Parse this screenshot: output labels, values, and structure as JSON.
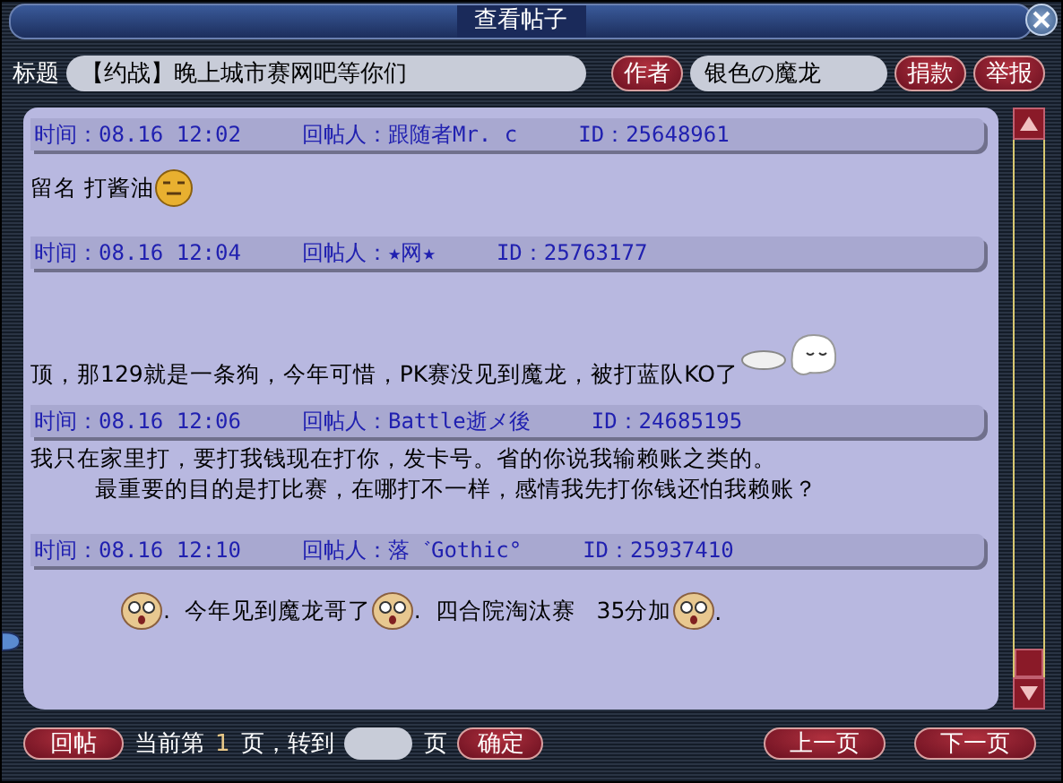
{
  "window": {
    "title": "查看帖子"
  },
  "subject": {
    "label": "标题",
    "value": "【约战】晚上城市赛网吧等你们"
  },
  "author": {
    "button": "作者",
    "value": "银色の魔龙"
  },
  "actions": [
    "捐款",
    "举报"
  ],
  "posts": [
    {
      "time_label": "时间：",
      "time": "08.16 12:02",
      "poster_label": "回帖人：",
      "poster": "跟随者Mr. c",
      "id_label": "ID：",
      "id": "25648961",
      "lines": [
        [
          {
            "kind": "text",
            "text": "留名 打酱油"
          },
          {
            "kind": "grin-face"
          }
        ]
      ]
    },
    {
      "time_label": "时间：",
      "time": "08.16 12:04",
      "poster_label": "回帖人：",
      "poster": "★网★",
      "id_label": "ID：",
      "id": "25763177",
      "lines": [
        [
          {
            "kind": "text",
            "text": "顶，那129就是一条狗，今年可惜，PK赛没见到魔龙，被打蓝队KO了"
          },
          {
            "kind": "ghost"
          }
        ]
      ]
    },
    {
      "time_label": "时间：",
      "time": "08.16 12:06",
      "poster_label": "回帖人：",
      "poster": "Battle逝メ後",
      "id_label": "ID：",
      "id": "24685195",
      "lines": [
        [
          {
            "kind": "text",
            "text": "我只在家里打，要打我钱现在打你，发卡号。省的你说我输赖账之类的。"
          }
        ],
        [
          {
            "kind": "text",
            "text": "最重要的目的是打比赛，在哪打不一样，感情我先打你钱还怕我赖账？"
          }
        ]
      ]
    },
    {
      "time_label": "时间：",
      "time": "08.16 12:10",
      "poster_label": "回帖人：",
      "poster": "落゛Gothic°",
      "id_label": "ID：",
      "id": "25937410",
      "lines": [
        [
          {
            "kind": "stare-face"
          },
          {
            "kind": "text",
            "text": ".  今年见到魔龙哥了"
          },
          {
            "kind": "stare-face"
          },
          {
            "kind": "text",
            "text": ".  四合院淘汰赛   35分加"
          },
          {
            "kind": "stare-face"
          },
          {
            "kind": "text",
            "text": "."
          }
        ]
      ]
    }
  ],
  "footer": {
    "reply": "回帖",
    "current_prefix": "当前第",
    "page": "1",
    "goto_prefix": "页，转到",
    "goto_suffix": "页",
    "confirm": "确定",
    "prev": "上一页",
    "next": "下一页"
  }
}
